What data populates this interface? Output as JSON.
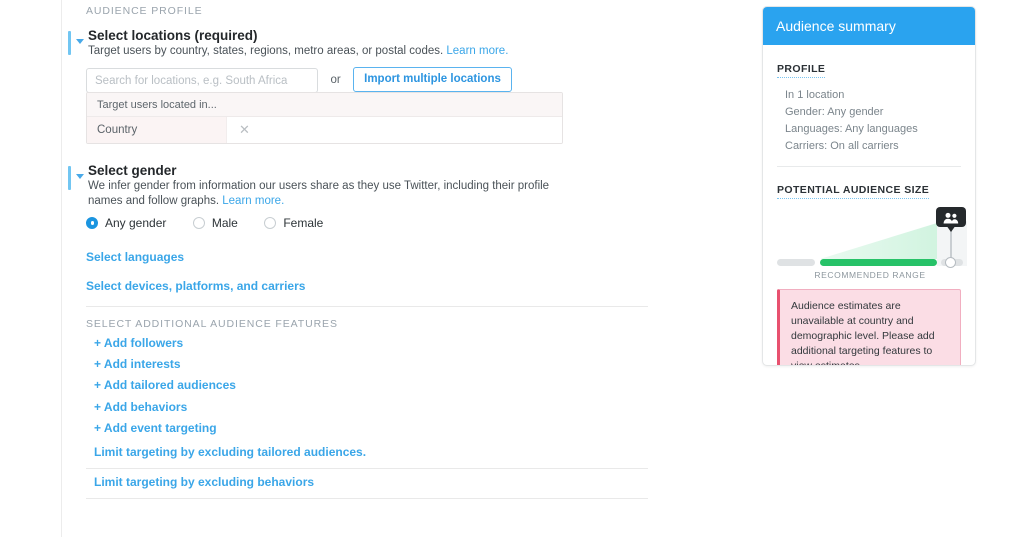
{
  "audience_profile": {
    "kicker": "AUDIENCE PROFILE"
  },
  "locations": {
    "title": "Select locations (required)",
    "description": "Target users by country, states, regions, metro areas, or postal codes.",
    "learn_more": "Learn more.",
    "search_placeholder": "Search for locations, e.g. South Africa",
    "search_value": "",
    "or_label": "or",
    "import_button": "Import multiple locations",
    "table_header": "Target users located in...",
    "rows": [
      {
        "name": "Country",
        "remove_icon": "✕"
      }
    ]
  },
  "gender": {
    "title": "Select gender",
    "description": "We infer gender from information our users share as they use Twitter, including their profile names and follow graphs.",
    "learn_more": "Learn more.",
    "options": [
      {
        "label": "Any gender",
        "selected": true
      },
      {
        "label": "Male",
        "selected": false
      },
      {
        "label": "Female",
        "selected": false
      }
    ]
  },
  "links": {
    "select_languages": "Select languages",
    "select_devices": "Select devices, platforms, and carriers"
  },
  "additional_features": {
    "kicker": "SELECT ADDITIONAL AUDIENCE FEATURES",
    "items": [
      "+ Add followers",
      "+ Add interests",
      "+ Add tailored audiences",
      "+ Add behaviors",
      "+ Add event targeting"
    ],
    "limits": [
      "Limit targeting by excluding tailored audiences.",
      "Limit targeting by excluding behaviors"
    ]
  },
  "summary": {
    "header": "Audience summary",
    "profile_label": "PROFILE",
    "profile_items": [
      "In 1 location",
      "Gender: Any gender",
      "Languages: Any languages",
      "Carriers: On all carriers"
    ],
    "size_label": "POTENTIAL AUDIENCE SIZE",
    "gauge_caption": "RECOMMENDED RANGE",
    "gauge_icon": "people-icon",
    "warning": "Audience estimates are unavailable at country and demographic level. Please add additional targeting features to view estimates."
  },
  "colors": {
    "accent_blue": "#2aa3ef",
    "link_blue": "#3aa6e8",
    "gauge_green": "#27c268",
    "warning_bg": "#fbdde5",
    "warning_border": "#e8516f"
  }
}
